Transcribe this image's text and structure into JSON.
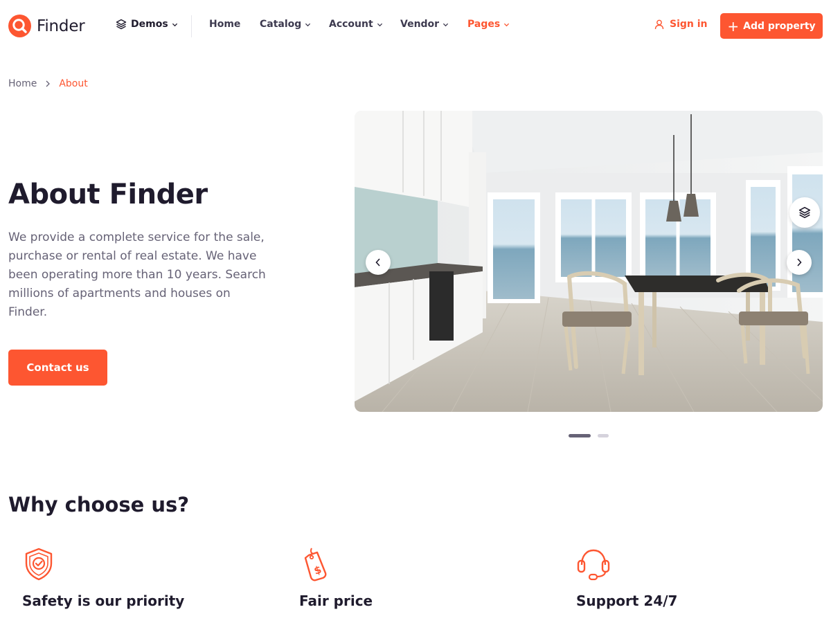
{
  "brand": {
    "name": "Finder",
    "accent": "#fd5631"
  },
  "header": {
    "demos_label": "Demos",
    "nav": [
      {
        "label": "Home",
        "dropdown": false,
        "active": false
      },
      {
        "label": "Catalog",
        "dropdown": true,
        "active": false
      },
      {
        "label": "Account",
        "dropdown": true,
        "active": false
      },
      {
        "label": "Vendor",
        "dropdown": true,
        "active": false
      },
      {
        "label": "Pages",
        "dropdown": true,
        "active": true
      }
    ],
    "signin_label": "Sign in",
    "add_property_label": "Add property"
  },
  "breadcrumb": {
    "home": "Home",
    "current": "About"
  },
  "hero": {
    "title": "About Finder",
    "description": "We provide a complete service for the sale, purchase or rental of real estate. We have been operating more than 10 years. Search millions of apartments and houses on Finder.",
    "cta_label": "Contact us"
  },
  "gallery": {
    "slides_total": 2,
    "active_slide": 1,
    "icons": [
      "chevron-left-icon",
      "chevron-right-icon",
      "layers-icon"
    ]
  },
  "why": {
    "title": "Why choose us?",
    "features": [
      {
        "title": "Safety is our priority",
        "icon": "shield-check-icon"
      },
      {
        "title": "Fair price",
        "icon": "price-tag-icon"
      },
      {
        "title": "Support 24/7",
        "icon": "headset-icon"
      }
    ]
  }
}
